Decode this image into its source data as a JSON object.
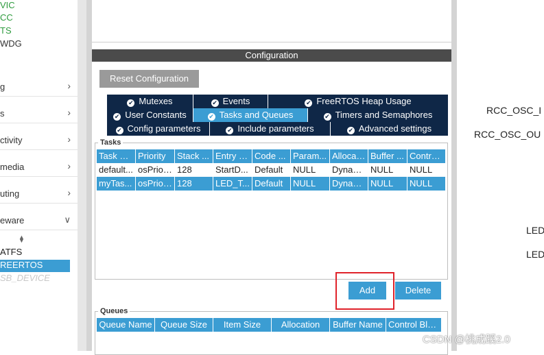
{
  "sidebar": {
    "items_top": [
      {
        "label": "VIC",
        "color": "#2e9b3e"
      },
      {
        "label": "CC",
        "color": "#2e9b3e"
      },
      {
        "label": "TS",
        "color": "#2e9b3e"
      },
      {
        "label": "WDG",
        "color": "#333333"
      }
    ],
    "categories": [
      {
        "label": "g"
      },
      {
        "label": "s"
      },
      {
        "label": "ctivity"
      },
      {
        "label": "media"
      },
      {
        "label": "uting"
      },
      {
        "label": "eware",
        "expanded": true
      }
    ],
    "middleware_items": [
      {
        "label": "ATFS",
        "state": "normal"
      },
      {
        "label": "REERTOS",
        "state": "selected"
      },
      {
        "label": "SB_DEVICE",
        "state": "disabled"
      }
    ],
    "selected_color": "#3b9dd3"
  },
  "config": {
    "header": "Configuration",
    "reset_label": "Reset Configuration",
    "tabs_row1": [
      "Mutexes",
      "Events",
      "FreeRTOS Heap Usage"
    ],
    "tabs_row2": [
      "User Constants",
      "Tasks and Queues",
      "Timers and Semaphores"
    ],
    "tabs_row3": [
      "Config parameters",
      "Include parameters",
      "Advanced settings"
    ],
    "active_tab": "Tasks and Queues"
  },
  "tasks": {
    "legend": "Tasks",
    "columns": [
      "Task N...",
      "Priority",
      "Stack ...",
      "Entry F...",
      "Code ...",
      "Param...",
      "Allocat...",
      "Buffer ...",
      "Control..."
    ],
    "rows": [
      [
        "default...",
        "osPrior...",
        "128",
        "StartD...",
        "Default",
        "NULL",
        "Dynamic",
        "NULL",
        "NULL"
      ],
      [
        "myTas...",
        "osPrior...",
        "128",
        "LED_T...",
        "Default",
        "NULL",
        "Dynamic",
        "NULL",
        "NULL"
      ]
    ],
    "selected_row": 1,
    "add_label": "Add",
    "delete_label": "Delete"
  },
  "queues": {
    "legend": "Queues",
    "columns": [
      "Queue Name",
      "Queue Size",
      "Item Size",
      "Allocation",
      "Buffer Name",
      "Control Blo..."
    ]
  },
  "right_labels": [
    "RCC_OSC_I",
    "RCC_OSC_OU",
    "LED",
    "LED"
  ],
  "watermark": "CSDN @桃成蹊2.0",
  "colors": {
    "accent": "#3b9dd3",
    "tab_dark": "#0f2747",
    "header_dark": "#4b4b4b",
    "highlight_red": "#e0222a"
  }
}
